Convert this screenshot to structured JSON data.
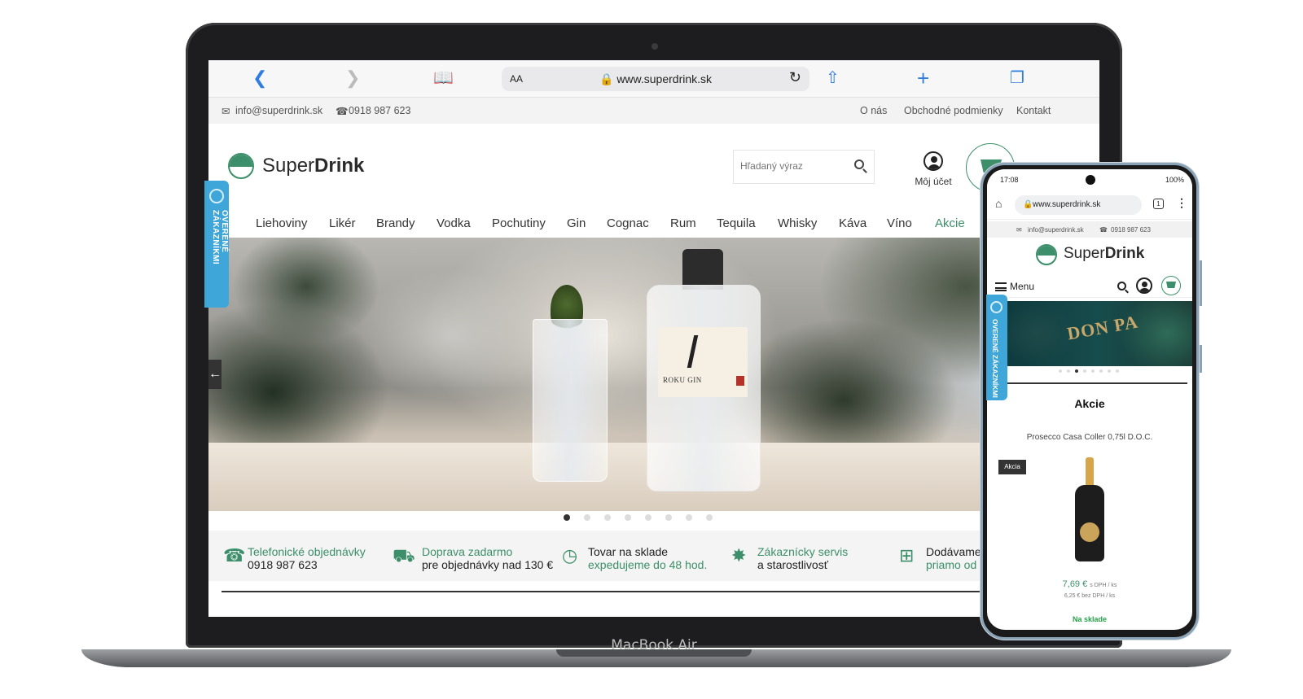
{
  "browser": {
    "url": "www.superdrink.sk",
    "aa": "AA"
  },
  "topbar": {
    "email": "info@superdrink.sk",
    "phone": "0918 987 623",
    "links": [
      "O nás",
      "Obchodné podmienky",
      "Kontakt"
    ]
  },
  "header": {
    "logo_light": "Super",
    "logo_bold": "Drink",
    "search_placeholder": "Hľadaný výraz",
    "account_label": "Môj účet"
  },
  "nav": [
    "Liehoviny",
    "Likér",
    "Brandy",
    "Vodka",
    "Pochutiny",
    "Gin",
    "Cognac",
    "Rum",
    "Tequila",
    "Whisky",
    "Káva",
    "Víno",
    "Akcie"
  ],
  "hero": {
    "bottle_label": "ROKU GIN",
    "slides": 8,
    "active_slide": 1
  },
  "features": [
    {
      "line1": "Telefonické objednávky",
      "line2": "0918 987 623"
    },
    {
      "line1": "Doprava zadarmo",
      "line2": "pre objednávky nad 130 €"
    },
    {
      "line1": "Tovar na sklade",
      "line2": "expedujeme do 48 hod."
    },
    {
      "line1": "Zákaznícky servis",
      "line2": "a starostlivosť"
    },
    {
      "line1": "Dodávame",
      "line2": "priamo od v"
    }
  ],
  "side_badge": "OVERENÉ ZÁKAZNÍKMI",
  "laptop_brand": "MacBook Air",
  "phone": {
    "time": "17:08",
    "battery": "100%",
    "url": "www.superdrink.sk",
    "tabs": "1",
    "menu_label": "Menu",
    "banner_text": "DON PA",
    "section_title": "Akcie",
    "product_name": "Prosecco Casa Coller 0,75l D.O.C.",
    "tag": "Akcia",
    "price": "7,69 €",
    "price_unit": "s DPH / ks",
    "price_net": "6,25 € bez DPH / ks",
    "stock": "Na sklade",
    "slides": 8,
    "active_slide": 3
  },
  "colors": {
    "brand_green": "#3c8f6a",
    "badge_blue": "#3ea6d8",
    "ios_blue": "#2f7de1"
  },
  "icons": [
    "chevron-left-icon",
    "chevron-right-icon",
    "book-icon",
    "lock-icon",
    "reload-icon",
    "share-icon",
    "plus-icon",
    "tabs-icon",
    "mail-icon",
    "phone-icon",
    "search-icon",
    "user-icon",
    "cart-icon",
    "truck-icon",
    "clock-icon",
    "badge-icon",
    "plus-square-icon",
    "home-icon",
    "menu-icon"
  ]
}
